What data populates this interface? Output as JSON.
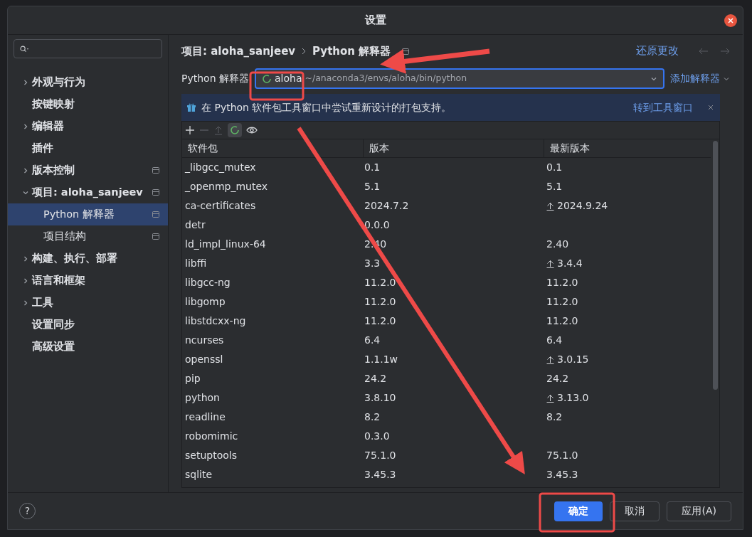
{
  "window": {
    "title": "设置"
  },
  "help_button": "?",
  "sidebar": {
    "items": [
      {
        "label": "外观与行为",
        "expandable": true,
        "expanded": false,
        "selected": false,
        "scoped": false
      },
      {
        "label": "按键映射",
        "expandable": false,
        "selected": false,
        "scoped": false
      },
      {
        "label": "编辑器",
        "expandable": true,
        "expanded": false,
        "selected": false,
        "scoped": false
      },
      {
        "label": "插件",
        "expandable": false,
        "selected": false,
        "scoped": false
      },
      {
        "label": "版本控制",
        "expandable": true,
        "expanded": false,
        "selected": false,
        "scoped": true
      },
      {
        "label": "项目: aloha_sanjeev",
        "expandable": true,
        "expanded": true,
        "selected": false,
        "scoped": true,
        "children": [
          {
            "label": "Python 解释器",
            "expandable": false,
            "selected": true,
            "scoped": true
          },
          {
            "label": "项目结构",
            "expandable": false,
            "selected": false,
            "scoped": true
          }
        ]
      },
      {
        "label": "构建、执行、部署",
        "expandable": true,
        "expanded": false,
        "selected": false,
        "scoped": false
      },
      {
        "label": "语言和框架",
        "expandable": true,
        "expanded": false,
        "selected": false,
        "scoped": false
      },
      {
        "label": "工具",
        "expandable": true,
        "expanded": false,
        "selected": false,
        "scoped": false
      },
      {
        "label": "设置同步",
        "expandable": false,
        "selected": false,
        "scoped": false
      },
      {
        "label": "高级设置",
        "expandable": false,
        "selected": false,
        "scoped": false
      }
    ]
  },
  "breadcrumb": [
    "项目: aloha_sanjeev",
    "Python 解释器"
  ],
  "revert_link": "还原更改",
  "interpreter": {
    "label": "Python 解释器",
    "name": "aloha",
    "path": "~/anaconda3/envs/aloha/bin/python",
    "add_button": "添加解释器"
  },
  "banner": {
    "text": "在 Python 软件包工具窗口中尝试重新设计的打包支持。",
    "link": "转到工具窗口"
  },
  "table": {
    "columns": [
      "软件包",
      "版本",
      "最新版本"
    ],
    "rows": [
      {
        "name": "_libgcc_mutex",
        "version": "0.1",
        "latest": "0.1",
        "upgradable": false
      },
      {
        "name": "_openmp_mutex",
        "version": "5.1",
        "latest": "5.1",
        "upgradable": false
      },
      {
        "name": "ca-certificates",
        "version": "2024.7.2",
        "latest": "2024.9.24",
        "upgradable": true
      },
      {
        "name": "detr",
        "version": "0.0.0",
        "latest": "",
        "upgradable": false
      },
      {
        "name": "ld_impl_linux-64",
        "version": "2.40",
        "latest": "2.40",
        "upgradable": false
      },
      {
        "name": "libffi",
        "version": "3.3",
        "latest": "3.4.4",
        "upgradable": true
      },
      {
        "name": "libgcc-ng",
        "version": "11.2.0",
        "latest": "11.2.0",
        "upgradable": false
      },
      {
        "name": "libgomp",
        "version": "11.2.0",
        "latest": "11.2.0",
        "upgradable": false
      },
      {
        "name": "libstdcxx-ng",
        "version": "11.2.0",
        "latest": "11.2.0",
        "upgradable": false
      },
      {
        "name": "ncurses",
        "version": "6.4",
        "latest": "6.4",
        "upgradable": false
      },
      {
        "name": "openssl",
        "version": "1.1.1w",
        "latest": "3.0.15",
        "upgradable": true
      },
      {
        "name": "pip",
        "version": "24.2",
        "latest": "24.2",
        "upgradable": false
      },
      {
        "name": "python",
        "version": "3.8.10",
        "latest": "3.13.0",
        "upgradable": true
      },
      {
        "name": "readline",
        "version": "8.2",
        "latest": "8.2",
        "upgradable": false
      },
      {
        "name": "robomimic",
        "version": "0.3.0",
        "latest": "",
        "upgradable": false
      },
      {
        "name": "setuptools",
        "version": "75.1.0",
        "latest": "75.1.0",
        "upgradable": false
      },
      {
        "name": "sqlite",
        "version": "3.45.3",
        "latest": "3.45.3",
        "upgradable": false
      }
    ]
  },
  "buttons": [
    {
      "label": "确定",
      "primary": true
    },
    {
      "label": "取消",
      "primary": false
    },
    {
      "label": "应用(A)",
      "primary": false
    }
  ]
}
